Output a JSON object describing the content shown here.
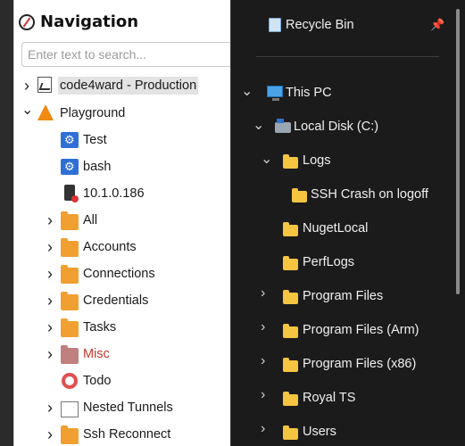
{
  "nav": {
    "title": "Navigation",
    "search_placeholder": "Enter text to search...",
    "items": [
      {
        "label": "code4ward - Production",
        "icon": "document-icon"
      },
      {
        "label": "Playground",
        "icon": "traffic-cone-icon"
      },
      {
        "label": "Test",
        "icon": "gear-icon"
      },
      {
        "label": "bash",
        "icon": "gear-icon"
      },
      {
        "label": "10.1.0.186",
        "icon": "server-icon"
      },
      {
        "label": "All",
        "icon": "folder-icon"
      },
      {
        "label": "Accounts",
        "icon": "folder-icon"
      },
      {
        "label": "Connections",
        "icon": "folder-icon"
      },
      {
        "label": "Credentials",
        "icon": "folder-icon"
      },
      {
        "label": "Tasks",
        "icon": "folder-icon"
      },
      {
        "label": "Misc",
        "icon": "folder-icon"
      },
      {
        "label": "Todo",
        "icon": "lifebuoy-icon"
      },
      {
        "label": "Nested Tunnels",
        "icon": "blank-icon"
      },
      {
        "label": "Ssh Reconnect",
        "icon": "folder-icon"
      }
    ]
  },
  "explorer": {
    "recycle_bin": "Recycle Bin",
    "this_pc": "This PC",
    "local_disk": "Local Disk (C:)",
    "folders": [
      {
        "label": "Logs"
      },
      {
        "label": "SSH Crash on logoff"
      },
      {
        "label": "NugetLocal"
      },
      {
        "label": "PerfLogs"
      },
      {
        "label": "Program Files"
      },
      {
        "label": "Program Files (Arm)"
      },
      {
        "label": "Program Files (x86)"
      },
      {
        "label": "Royal TS"
      },
      {
        "label": "Users"
      }
    ]
  },
  "colors": {
    "folder_orange": "#f0a030",
    "misc_red": "#c0392b",
    "folder_yellow": "#f5c542",
    "dark_bg": "#1b1b1b"
  }
}
